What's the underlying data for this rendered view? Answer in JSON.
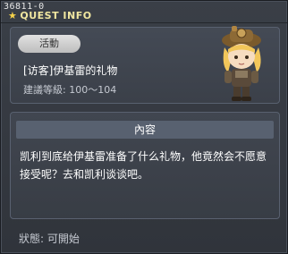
{
  "quest_id": "36811-0",
  "window_title": "QUEST INFO",
  "tag_label": "活動",
  "quest_name": "[访客]伊基雷的礼物",
  "level_label": "建議等級: 100～104",
  "npc_icon": "npc-character-portrait",
  "content_header": "內容",
  "content_text": "凯利到底给伊基雷准备了什么礼物，他竟然会不愿意接受呢？去和凯利谈谈吧。",
  "status_label": "狀態:",
  "status_value": "可開始",
  "colors": {
    "title": "#f0e6a0",
    "header_bar": "#586170",
    "tag": "#d6d6d6"
  }
}
